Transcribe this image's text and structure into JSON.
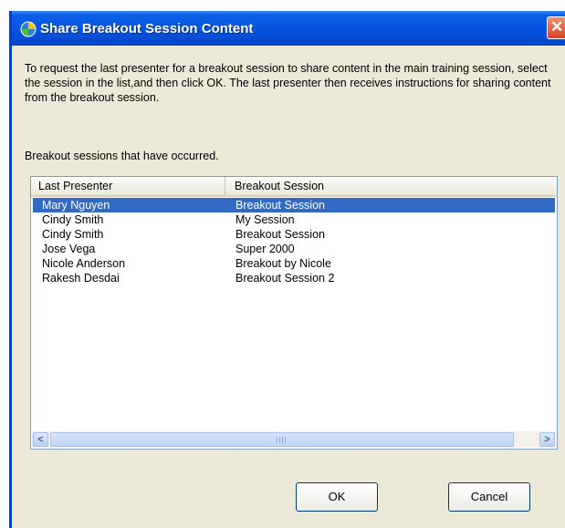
{
  "window": {
    "title": "Share Breakout Session Content",
    "close_label": "✕"
  },
  "description": "To request the last presenter for a breakout session to share content in the main training session, select the session in the list,and then click OK. The last presenter then receives instructions for sharing content from the breakout session.",
  "subheading": "Breakout sessions that have occurred.",
  "table": {
    "columns": [
      "Last Presenter",
      "Breakout Session"
    ],
    "rows": [
      {
        "presenter": "Mary Nguyen",
        "session": "Breakout Session",
        "selected": true
      },
      {
        "presenter": "Cindy Smith",
        "session": "My Session",
        "selected": false
      },
      {
        "presenter": "Cindy Smith",
        "session": "Breakout Session",
        "selected": false
      },
      {
        "presenter": "Jose Vega",
        "session": "Super 2000",
        "selected": false
      },
      {
        "presenter": "Nicole Anderson",
        "session": "Breakout by Nicole",
        "selected": false
      },
      {
        "presenter": "Rakesh Desdai",
        "session": "Breakout Session 2",
        "selected": false
      }
    ]
  },
  "scrollbar": {
    "left_arrow": "<",
    "right_arrow": ">"
  },
  "buttons": {
    "ok": "OK",
    "cancel": "Cancel"
  },
  "colors": {
    "titlebar": "#0553e0",
    "selection": "#316ac5",
    "close": "#d9412a"
  },
  "icons": {
    "title": "webex-globe-icon",
    "close": "close-icon"
  }
}
